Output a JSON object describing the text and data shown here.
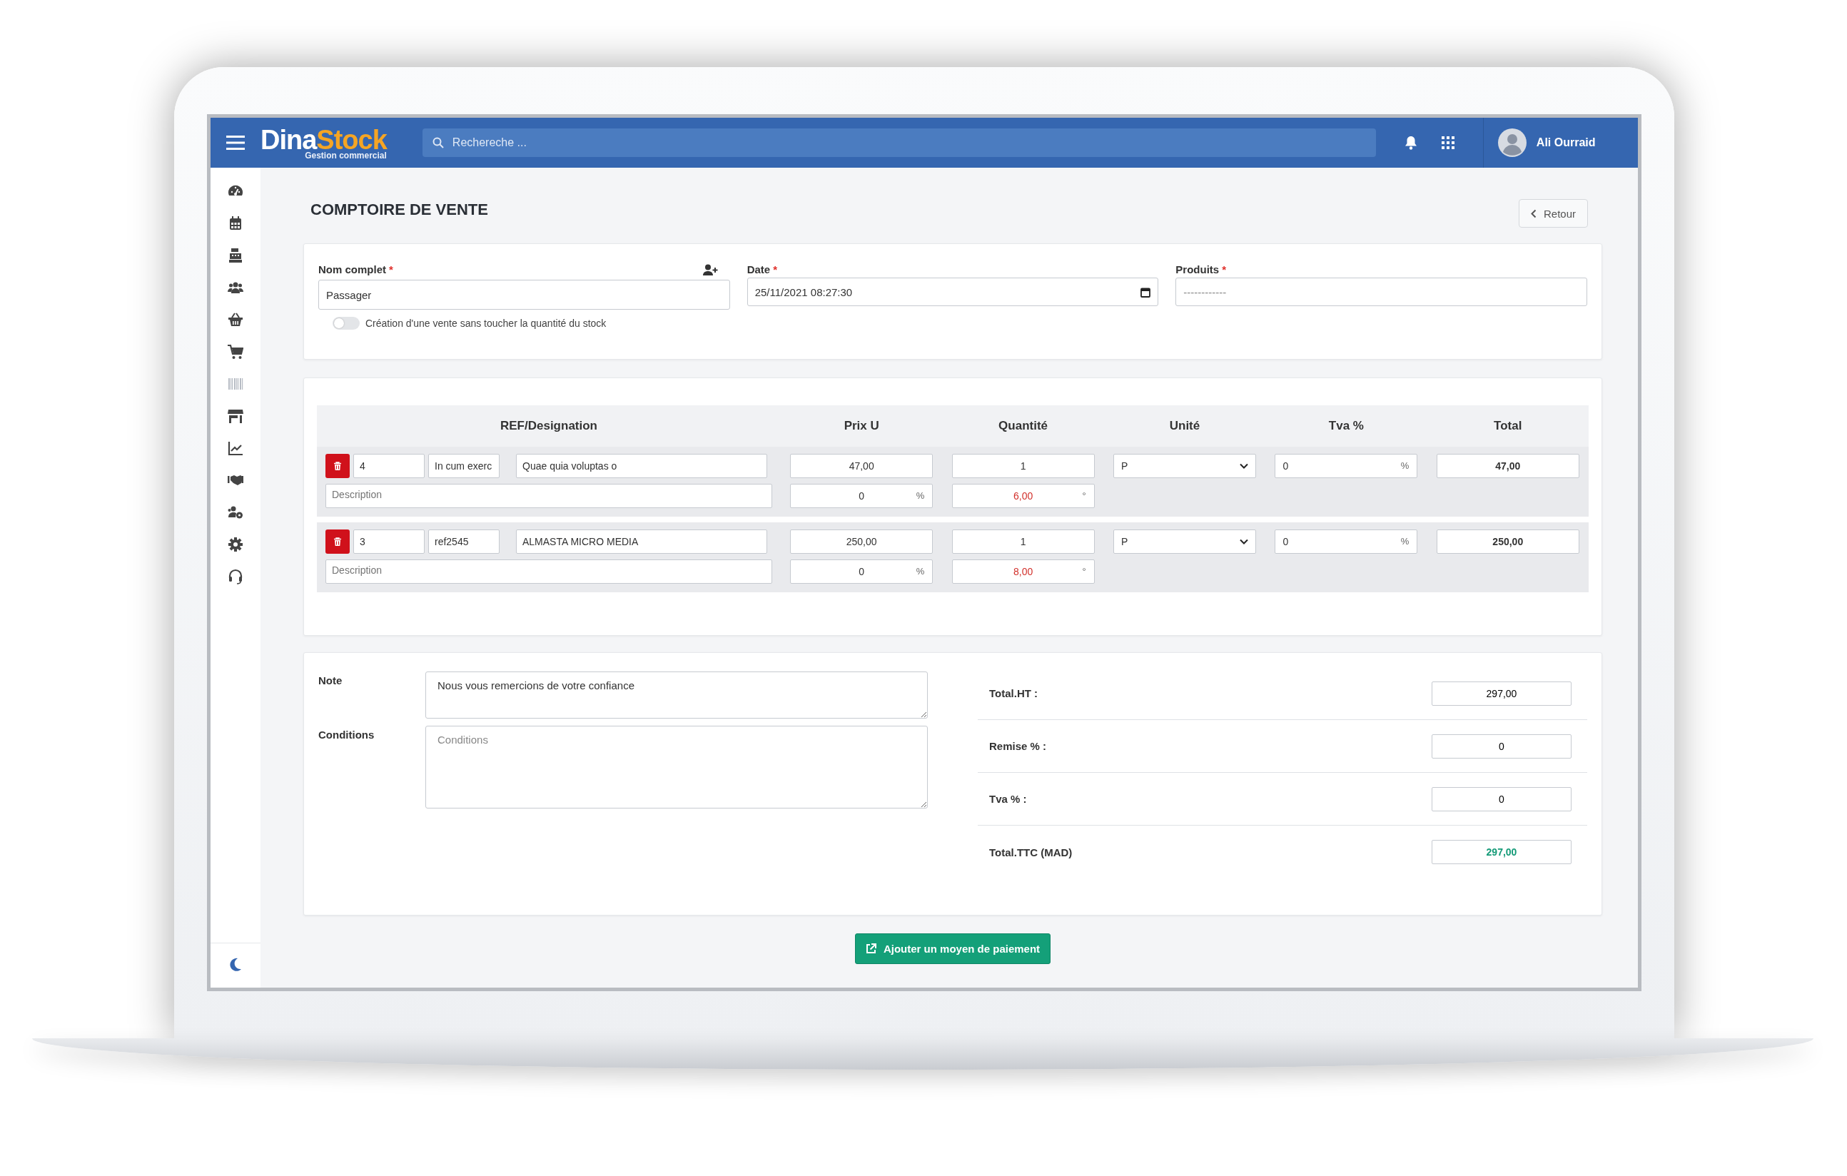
{
  "header": {
    "brand": {
      "part_1": "Dina",
      "part_2": "Stock",
      "tagline": "Gestion commercial"
    },
    "search": {
      "placeholder": "Rechereche ..."
    },
    "user": {
      "name": "Ali Ourraid"
    }
  },
  "page": {
    "title": "COMPTOIRE DE VENTE",
    "back_button": "Retour"
  },
  "form": {
    "name": {
      "label": "Nom complet",
      "mark": "*",
      "value": "Passager"
    },
    "date": {
      "label": "Date",
      "mark": "*",
      "value": "25/11/2021 08:27:30"
    },
    "products": {
      "label": "Produits",
      "mark": "*",
      "placeholder": "------------"
    },
    "stock_toggle": {
      "label": "Création d'une vente sans toucher la quantité du stock",
      "on": false
    }
  },
  "table": {
    "columns": [
      "REF/Designation",
      "Prix U",
      "Quantité",
      "Unité",
      "Tva %",
      "Total"
    ],
    "rows": [
      {
        "id": "4",
        "ref": "In cum exerc",
        "designation": "Quae quia voluptas o",
        "price": "47,00",
        "quantity": "1",
        "unit": "P",
        "tva": "0",
        "tva_unit": "%",
        "total": "47,00",
        "description_placeholder": "Description",
        "discount": "0",
        "discount_unit": "%",
        "amount": "6,00",
        "amount_unit": "°"
      },
      {
        "id": "3",
        "ref": "ref2545",
        "designation": "ALMASTA MICRO MEDIA",
        "price": "250,00",
        "quantity": "1",
        "unit": "P",
        "tva": "0",
        "tva_unit": "%",
        "total": "250,00",
        "description_placeholder": "Description",
        "discount": "0",
        "discount_unit": "%",
        "amount": "8,00",
        "amount_unit": "°"
      }
    ]
  },
  "notes": {
    "note": {
      "label": "Note",
      "value": "Nous vous remercions de votre confiance"
    },
    "conditions": {
      "label": "Conditions",
      "placeholder": "Conditions"
    }
  },
  "totals": [
    {
      "label": "Total.HT :",
      "value": "297,00",
      "kind": "plain"
    },
    {
      "label": "Remise % :",
      "value": "0",
      "kind": "plain"
    },
    {
      "label": "Tva % :",
      "value": "0",
      "kind": "plain"
    },
    {
      "label": "Total.TTC (MAD)",
      "value": "297,00",
      "kind": "grand"
    }
  ],
  "payment_button": "Ajouter un moyen de paiement"
}
